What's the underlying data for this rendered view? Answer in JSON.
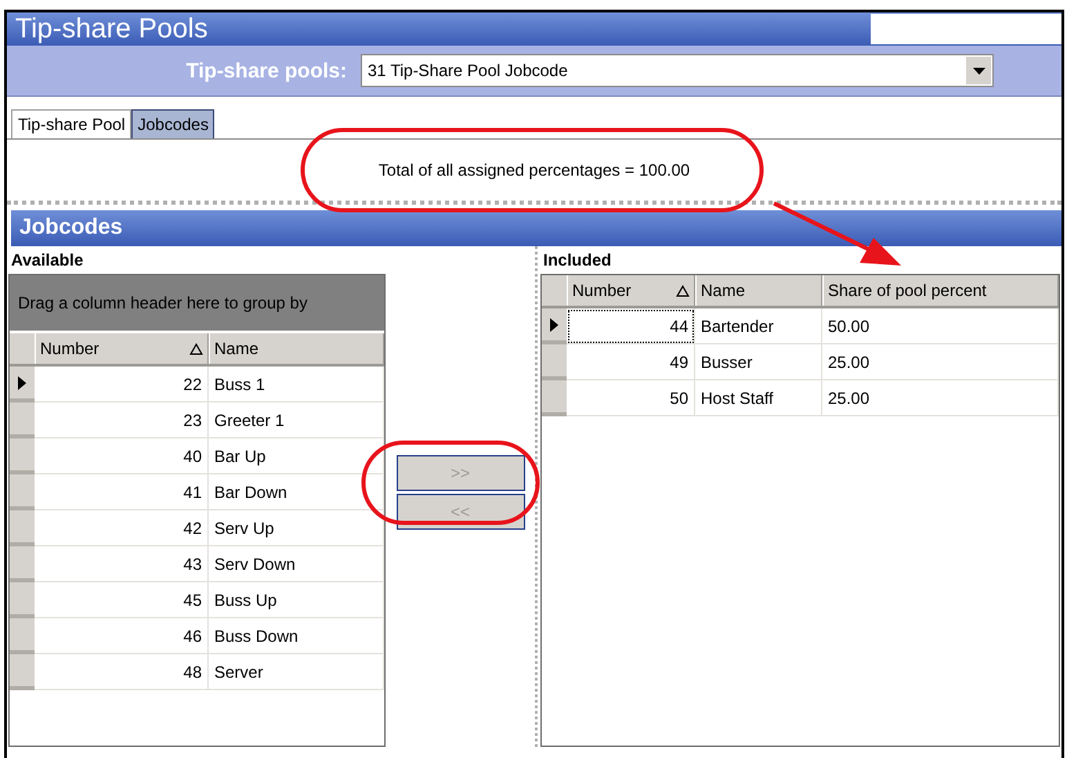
{
  "window": {
    "title": "Tip-share Pools"
  },
  "toolbar": {
    "label": "Tip-share pools:",
    "pool_select": {
      "value": "31 Tip-Share Pool Jobcode"
    }
  },
  "tabs": [
    {
      "label": "Tip-share Pool",
      "selected": false
    },
    {
      "label": "Jobcodes",
      "selected": true
    }
  ],
  "summary": "Total of all assigned percentages = 100.00",
  "section": {
    "title": "Jobcodes"
  },
  "available": {
    "title": "Available",
    "group_hint": "Drag a column header here to group by",
    "columns": [
      {
        "label": "Number",
        "kind": "number",
        "sorted": true
      },
      {
        "label": "Name",
        "kind": "text",
        "sorted": false
      }
    ],
    "rows": [
      {
        "cells": [
          "22",
          "Buss 1"
        ],
        "selected": true
      },
      {
        "cells": [
          "23",
          "Greeter 1"
        ],
        "selected": false
      },
      {
        "cells": [
          "40",
          "Bar Up"
        ],
        "selected": false
      },
      {
        "cells": [
          "41",
          "Bar Down"
        ],
        "selected": false
      },
      {
        "cells": [
          "42",
          "Serv Up"
        ],
        "selected": false
      },
      {
        "cells": [
          "43",
          "Serv Down"
        ],
        "selected": false
      },
      {
        "cells": [
          "45",
          "Buss Up"
        ],
        "selected": false
      },
      {
        "cells": [
          "46",
          "Buss Down"
        ],
        "selected": false
      },
      {
        "cells": [
          "48",
          "Server"
        ],
        "selected": false
      }
    ]
  },
  "move_buttons": [
    {
      "label": ">>",
      "disabled": true
    },
    {
      "label": "<<",
      "disabled": true
    }
  ],
  "included": {
    "title": "Included",
    "columns": [
      {
        "label": "Number",
        "kind": "number",
        "sorted": true
      },
      {
        "label": "Name",
        "kind": "text",
        "sorted": false
      },
      {
        "label": "Share of pool percent",
        "kind": "text",
        "sorted": false
      }
    ],
    "rows": [
      {
        "cells": [
          "44",
          "Bartender",
          "50.00"
        ],
        "selected": true
      },
      {
        "cells": [
          "49",
          "Busser",
          "25.00"
        ],
        "selected": false
      },
      {
        "cells": [
          "50",
          "Host Staff",
          "25.00"
        ],
        "selected": false
      }
    ]
  },
  "callouts": [
    {
      "kind": "ellipse"
    },
    {
      "kind": "ellipse"
    },
    {
      "kind": "arrow"
    }
  ]
}
